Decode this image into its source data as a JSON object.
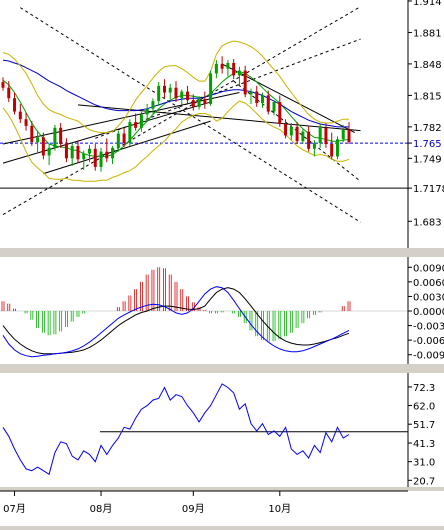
{
  "chart_data": [
    {
      "type": "line",
      "panel": "price",
      "subtype": "candlestick",
      "ylim": [
        1.655,
        1.915
      ],
      "y_ticks": [
        1.683,
        1.7178,
        1.749,
        1.765,
        1.782,
        1.815,
        1.848,
        1.881,
        1.914
      ],
      "y_tick_labels": [
        "1.683",
        "1.7178",
        "1.749",
        "1.765",
        "1.782",
        "1.815",
        "1.848",
        "1.881",
        "1.914"
      ],
      "current_price": "1.765",
      "candles": [
        [
          1.829,
          1.834,
          1.82,
          1.823
        ],
        [
          1.823,
          1.83,
          1.808,
          1.812
        ],
        [
          1.812,
          1.818,
          1.795,
          1.798
        ],
        [
          1.798,
          1.806,
          1.786,
          1.79
        ],
        [
          1.79,
          1.797,
          1.778,
          1.783
        ],
        [
          1.783,
          1.788,
          1.762,
          1.766
        ],
        [
          1.766,
          1.778,
          1.754,
          1.771
        ],
        [
          1.771,
          1.776,
          1.748,
          1.752
        ],
        [
          1.752,
          1.764,
          1.742,
          1.76
        ],
        [
          1.76,
          1.784,
          1.757,
          1.781
        ],
        [
          1.781,
          1.786,
          1.76,
          1.764
        ],
        [
          1.764,
          1.77,
          1.745,
          1.749
        ],
        [
          1.749,
          1.765,
          1.741,
          1.762
        ],
        [
          1.762,
          1.768,
          1.744,
          1.748
        ],
        [
          1.748,
          1.757,
          1.737,
          1.754
        ],
        [
          1.754,
          1.763,
          1.745,
          1.759
        ],
        [
          1.759,
          1.764,
          1.736,
          1.74
        ],
        [
          1.74,
          1.76,
          1.735,
          1.756
        ],
        [
          1.756,
          1.77,
          1.745,
          1.749
        ],
        [
          1.749,
          1.762,
          1.743,
          1.76
        ],
        [
          1.76,
          1.778,
          1.756,
          1.775
        ],
        [
          1.775,
          1.781,
          1.761,
          1.765
        ],
        [
          1.765,
          1.79,
          1.762,
          1.787
        ],
        [
          1.787,
          1.796,
          1.778,
          1.781
        ],
        [
          1.781,
          1.798,
          1.777,
          1.795
        ],
        [
          1.795,
          1.806,
          1.787,
          1.801
        ],
        [
          1.801,
          1.812,
          1.796,
          1.809
        ],
        [
          1.809,
          1.829,
          1.804,
          1.825
        ],
        [
          1.825,
          1.832,
          1.812,
          1.818
        ],
        [
          1.818,
          1.827,
          1.811,
          1.823
        ],
        [
          1.823,
          1.83,
          1.808,
          1.812
        ],
        [
          1.812,
          1.821,
          1.805,
          1.819
        ],
        [
          1.819,
          1.825,
          1.806,
          1.81
        ],
        [
          1.81,
          1.816,
          1.799,
          1.803
        ],
        [
          1.803,
          1.814,
          1.8,
          1.811
        ],
        [
          1.811,
          1.819,
          1.801,
          1.806
        ],
        [
          1.806,
          1.841,
          1.804,
          1.838
        ],
        [
          1.838,
          1.852,
          1.833,
          1.848
        ],
        [
          1.848,
          1.856,
          1.838,
          1.843
        ],
        [
          1.843,
          1.852,
          1.835,
          1.849
        ],
        [
          1.849,
          1.853,
          1.832,
          1.836
        ],
        [
          1.836,
          1.845,
          1.826,
          1.841
        ],
        [
          1.841,
          1.846,
          1.813,
          1.816
        ],
        [
          1.816,
          1.822,
          1.806,
          1.819
        ],
        [
          1.819,
          1.825,
          1.803,
          1.807
        ],
        [
          1.807,
          1.818,
          1.802,
          1.815
        ],
        [
          1.815,
          1.82,
          1.795,
          1.798
        ],
        [
          1.798,
          1.81,
          1.794,
          1.808
        ],
        [
          1.808,
          1.815,
          1.782,
          1.785
        ],
        [
          1.785,
          1.79,
          1.77,
          1.773
        ],
        [
          1.773,
          1.786,
          1.768,
          1.782
        ],
        [
          1.782,
          1.787,
          1.764,
          1.767
        ],
        [
          1.767,
          1.78,
          1.764,
          1.777
        ],
        [
          1.777,
          1.783,
          1.756,
          1.759
        ],
        [
          1.759,
          1.768,
          1.751,
          1.765
        ],
        [
          1.765,
          1.785,
          1.76,
          1.781
        ],
        [
          1.781,
          1.786,
          1.76,
          1.764
        ],
        [
          1.764,
          1.776,
          1.748,
          1.751
        ],
        [
          1.751,
          1.772,
          1.748,
          1.769
        ],
        [
          1.769,
          1.784,
          1.766,
          1.779
        ],
        [
          1.779,
          1.787,
          1.764,
          1.766
        ]
      ],
      "overlays": [
        {
          "name": "ma-short",
          "color": "#00a000",
          "values": [
            1.831,
            1.826,
            1.818,
            1.808,
            1.797,
            1.786,
            1.777,
            1.77,
            1.764,
            1.762,
            1.761,
            1.76,
            1.758,
            1.757,
            1.754,
            1.752,
            1.751,
            1.751,
            1.751,
            1.753,
            1.757,
            1.762,
            1.768,
            1.775,
            1.782,
            1.788,
            1.795,
            1.801,
            1.806,
            1.81,
            1.813,
            1.815,
            1.815,
            1.814,
            1.813,
            1.813,
            1.817,
            1.823,
            1.829,
            1.834,
            1.838,
            1.84,
            1.838,
            1.834,
            1.829,
            1.823,
            1.817,
            1.812,
            1.807,
            1.8,
            1.793,
            1.786,
            1.78,
            1.775,
            1.771,
            1.77,
            1.769,
            1.767,
            1.767,
            1.768,
            1.769
          ]
        },
        {
          "name": "ma-long",
          "color": "#0000c0",
          "values": [
            1.852,
            1.851,
            1.849,
            1.847,
            1.844,
            1.841,
            1.838,
            1.834,
            1.83,
            1.827,
            1.824,
            1.82,
            1.817,
            1.814,
            1.811,
            1.808,
            1.805,
            1.803,
            1.801,
            1.8,
            1.799,
            1.799,
            1.799,
            1.799,
            1.8,
            1.801,
            1.803,
            1.805,
            1.807,
            1.809,
            1.81,
            1.811,
            1.812,
            1.812,
            1.812,
            1.813,
            1.815,
            1.817,
            1.819,
            1.82,
            1.821,
            1.821,
            1.82,
            1.819,
            1.817,
            1.815,
            1.812,
            1.809,
            1.806,
            1.802,
            1.798,
            1.795,
            1.792,
            1.789,
            1.787,
            1.785,
            1.784,
            1.783,
            1.782,
            1.782,
            1.782
          ]
        },
        {
          "name": "bb-upper",
          "color": "#c8b400",
          "values": [
            1.86,
            1.858,
            1.853,
            1.846,
            1.838,
            1.827,
            1.815,
            1.806,
            1.8,
            1.797,
            1.795,
            1.792,
            1.79,
            1.788,
            1.783,
            1.779,
            1.777,
            1.776,
            1.776,
            1.777,
            1.783,
            1.79,
            1.8,
            1.81,
            1.818,
            1.825,
            1.833,
            1.84,
            1.845,
            1.846,
            1.846,
            1.843,
            1.839,
            1.834,
            1.83,
            1.83,
            1.84,
            1.858,
            1.867,
            1.87,
            1.872,
            1.871,
            1.869,
            1.866,
            1.862,
            1.856,
            1.849,
            1.842,
            1.835,
            1.826,
            1.818,
            1.81,
            1.802,
            1.795,
            1.79,
            1.787,
            1.786,
            1.786,
            1.788,
            1.79,
            1.79
          ]
        },
        {
          "name": "bb-lower",
          "color": "#c8b400",
          "values": [
            1.802,
            1.794,
            1.783,
            1.77,
            1.756,
            1.745,
            1.739,
            1.734,
            1.728,
            1.727,
            1.727,
            1.728,
            1.726,
            1.726,
            1.725,
            1.725,
            1.725,
            1.726,
            1.726,
            1.729,
            1.731,
            1.734,
            1.736,
            1.74,
            1.746,
            1.751,
            1.757,
            1.762,
            1.767,
            1.774,
            1.78,
            1.787,
            1.791,
            1.794,
            1.796,
            1.796,
            1.794,
            1.788,
            1.791,
            1.798,
            1.804,
            1.809,
            1.807,
            1.802,
            1.796,
            1.79,
            1.785,
            1.782,
            1.779,
            1.774,
            1.768,
            1.762,
            1.758,
            1.755,
            1.752,
            1.753,
            1.752,
            1.748,
            1.746,
            1.746,
            1.748
          ]
        }
      ],
      "trendlines": [
        {
          "style": "solid",
          "points": [
            [
              0,
              1.744
            ],
            [
              36,
              1.808
            ]
          ]
        },
        {
          "style": "solid",
          "points": [
            [
              7,
              1.733
            ],
            [
              36,
              1.788
            ]
          ]
        },
        {
          "style": "solid",
          "points": [
            [
              0,
              1.764
            ],
            [
              41,
              1.818
            ]
          ]
        },
        {
          "style": "solid",
          "points": [
            [
              38,
              1.848
            ],
            [
              61,
              1.776
            ]
          ]
        },
        {
          "style": "solid",
          "points": [
            [
              13,
              1.805
            ],
            [
              62,
              1.778
            ]
          ]
        },
        {
          "style": "solid",
          "points": [
            [
              0,
              1.7178
            ],
            [
              62,
              1.7178
            ]
          ]
        },
        {
          "style": "dashed",
          "points": [
            [
              3,
              1.907
            ],
            [
              62,
              1.682
            ]
          ]
        },
        {
          "style": "dashed",
          "points": [
            [
              40,
              1.83
            ],
            [
              62,
              1.725
            ]
          ]
        },
        {
          "style": "dashed",
          "points": [
            [
              0,
              1.69
            ],
            [
              62,
              1.908
            ]
          ]
        },
        {
          "style": "dashed",
          "points": [
            [
              16,
              1.77
            ],
            [
              62,
              1.874
            ]
          ]
        }
      ]
    },
    {
      "type": "bar",
      "panel": "macd",
      "ylim": [
        -0.0105,
        0.0105
      ],
      "y_ticks": [
        0.009,
        0.006,
        0.003,
        0.0,
        -0.003,
        -0.006,
        -0.009
      ],
      "y_tick_labels": [
        "0.0090",
        "0.0060",
        "0.0030",
        "0.0000",
        "-0.003",
        "-0.006",
        "-0.009"
      ],
      "histogram": [
        0.002,
        0.0015,
        0.0005,
        0,
        -0.0005,
        -0.0018,
        -0.0035,
        -0.0045,
        -0.005,
        -0.0048,
        -0.0042,
        -0.0033,
        -0.0022,
        -0.0012,
        -0.0005,
        0,
        0,
        0,
        0,
        0,
        0.0008,
        0.002,
        0.0032,
        0.0045,
        0.006,
        0.0075,
        0.0085,
        0.009,
        0.0088,
        0.0075,
        0.006,
        0.0045,
        0.003,
        0.0018,
        0.0008,
        0.0002,
        -0.0005,
        -0.0005,
        -0.0003,
        0,
        -0.0005,
        -0.0012,
        -0.0025,
        -0.004,
        -0.0052,
        -0.006,
        -0.0063,
        -0.0062,
        -0.0058,
        -0.0052,
        -0.0045,
        -0.0035,
        -0.0025,
        -0.0015,
        -0.0008,
        -0.0003,
        0,
        0,
        0,
        0.001,
        0.002
      ],
      "series": [
        {
          "color": "#000000",
          "values": [
            -0.003,
            -0.0045,
            -0.0058,
            -0.0068,
            -0.0076,
            -0.0082,
            -0.0086,
            -0.0088,
            -0.0088,
            -0.0088,
            -0.0087,
            -0.0086,
            -0.0085,
            -0.0083,
            -0.008,
            -0.0075,
            -0.0068,
            -0.006,
            -0.005,
            -0.004,
            -0.003,
            -0.0022,
            -0.0015,
            -0.0008,
            -0.0003,
            0,
            0.0005,
            0.0008,
            0.001,
            0.001,
            0.0008,
            0.0006,
            0.0004,
            0.0003,
            0.0005,
            0.001,
            0.0025,
            0.0038,
            0.0045,
            0.0048,
            0.0045,
            0.0038,
            0.0025,
            0.001,
            -0.0005,
            -0.002,
            -0.0033,
            -0.0045,
            -0.0055,
            -0.0062,
            -0.0066,
            -0.0069,
            -0.007,
            -0.007,
            -0.0068,
            -0.0065,
            -0.0062,
            -0.0058,
            -0.0055,
            -0.005,
            -0.0046
          ]
        },
        {
          "color": "#0000ff",
          "values": [
            -0.005,
            -0.0068,
            -0.008,
            -0.0088,
            -0.0092,
            -0.0094,
            -0.0093,
            -0.0091,
            -0.009,
            -0.0088,
            -0.0087,
            -0.0085,
            -0.0082,
            -0.0078,
            -0.0072,
            -0.0064,
            -0.0055,
            -0.0045,
            -0.0035,
            -0.0025,
            -0.0015,
            -0.0008,
            -0.0002,
            0.0004,
            0.0008,
            0.0012,
            0.0014,
            0.0013,
            0.0009,
            0.0003,
            -0.0004,
            -0.0007,
            -0.0004,
            0.0005,
            0.002,
            0.0035,
            0.0045,
            0.005,
            0.0048,
            0.0038,
            0.0022,
            0.0005,
            -0.0012,
            -0.0028,
            -0.0042,
            -0.0054,
            -0.0064,
            -0.0072,
            -0.0078,
            -0.0082,
            -0.0084,
            -0.0084,
            -0.0082,
            -0.0078,
            -0.0073,
            -0.0068,
            -0.0063,
            -0.0058,
            -0.0052,
            -0.0046,
            -0.004
          ]
        }
      ]
    },
    {
      "type": "line",
      "panel": "oscillator",
      "ylim": [
        17,
        80
      ],
      "y_ticks": [
        72.3,
        62.0,
        51.7,
        41.3,
        31.0,
        20.7
      ],
      "y_tick_labels": [
        "72.3",
        "62.0",
        "51.7",
        "41.3",
        "31.0",
        "20.7"
      ],
      "reference_level": 47.5,
      "series": [
        {
          "color": "#0000ff",
          "values": [
            50,
            45,
            38,
            32,
            27,
            26,
            28,
            26,
            24,
            36,
            42,
            41,
            34,
            32,
            37,
            35,
            31,
            40,
            35,
            40,
            44,
            50,
            49,
            55,
            60,
            62,
            65,
            66,
            72,
            65,
            68,
            67,
            62,
            58,
            53,
            58,
            62,
            68,
            74,
            72,
            69,
            60,
            63,
            52,
            48,
            52,
            46,
            48,
            45,
            50,
            38,
            35,
            37,
            33,
            40,
            36,
            47,
            42,
            50,
            44,
            46
          ]
        }
      ]
    }
  ],
  "x_axis": {
    "labels": [
      "07月",
      "08月",
      "09月",
      "10月"
    ],
    "label_index": [
      2,
      17,
      33,
      48
    ]
  }
}
